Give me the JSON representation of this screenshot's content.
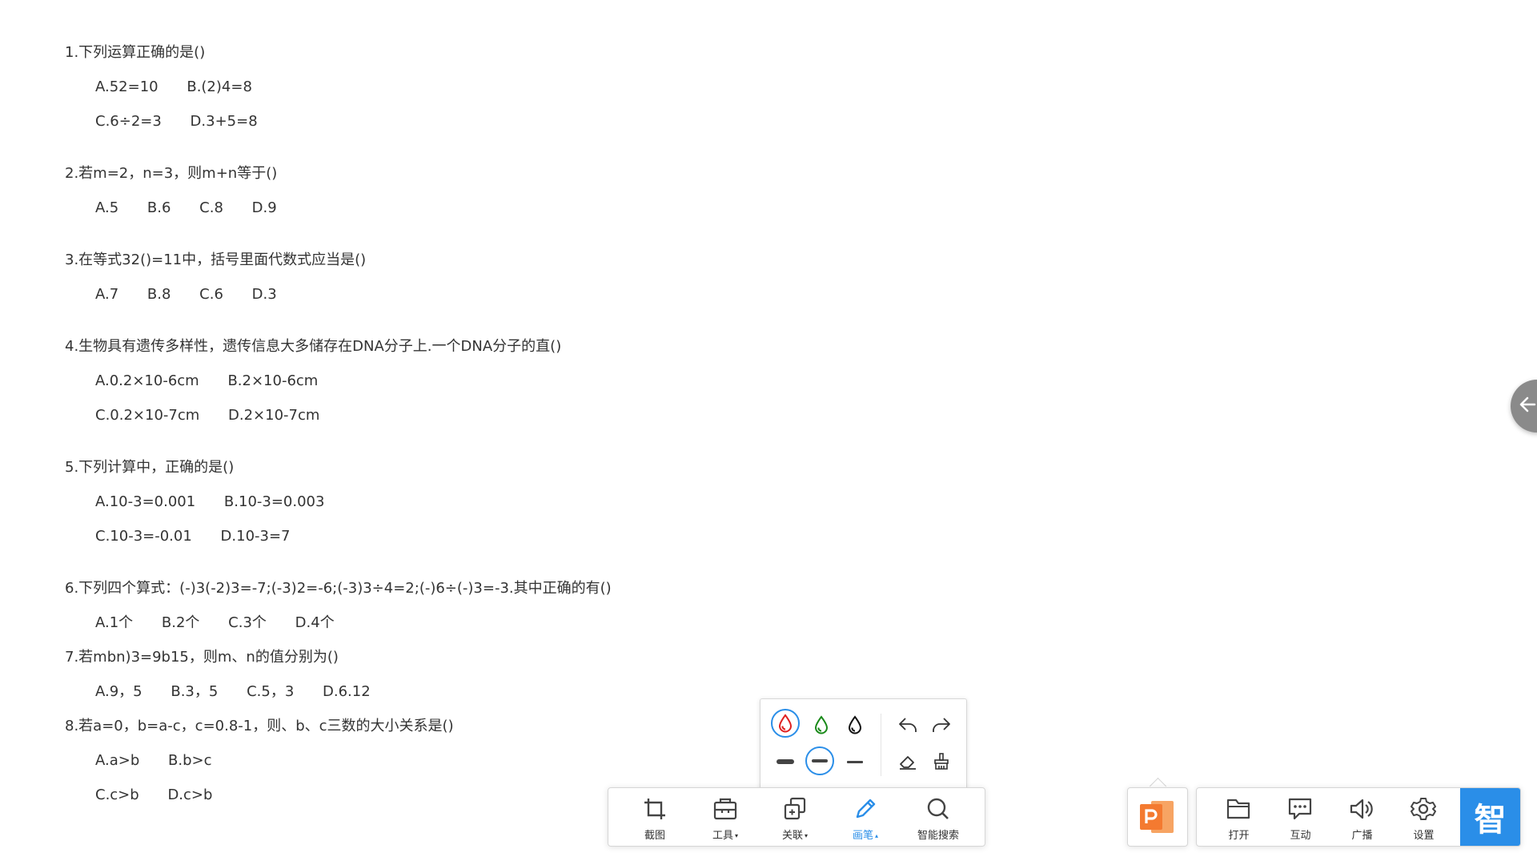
{
  "questions": [
    {
      "text": "1.下列运算正确的是()",
      "rows": [
        [
          "A.52=10",
          "B.(2)4=8"
        ],
        [
          "C.6÷2=3",
          "D.3+5=8"
        ]
      ]
    },
    {
      "text": "2.若m=2，n=3，则m+n等于()",
      "rows": [
        [
          "A.5",
          "B.6",
          "C.8",
          "D.9"
        ]
      ]
    },
    {
      "text": "3.在等式32()=11中，括号里面代数式应当是()",
      "rows": [
        [
          "A.7",
          "B.8",
          "C.6",
          "D.3"
        ]
      ]
    },
    {
      "text": "4.生物具有遗传多样性，遗传信息大多储存在DNA分子上.一个DNA分子的直()",
      "rows": [
        [
          "A.0.2×10-6cm",
          "B.2×10-6cm"
        ],
        [
          "C.0.2×10-7cm",
          "D.2×10-7cm"
        ]
      ]
    },
    {
      "text": "5.下列计算中，正确的是()",
      "rows": [
        [
          "A.10-3=0.001",
          "B.10-3=0.003"
        ],
        [
          "C.10-3=-0.01",
          "D.10-3=7"
        ]
      ]
    },
    {
      "text": "6.下列四个算式：(-)3(-2)3=-7;(-3)2=-6;(-3)3÷4=2;(-)6÷(-)3=-3.其中正确的有()",
      "rows": [
        [
          "A.1个",
          "B.2个",
          "C.3个",
          "D.4个"
        ]
      ]
    },
    {
      "text": "7.若mbn)3=9b15，则m、n的值分别为()",
      "rows": [
        [
          "A.9，5",
          "B.3，5",
          "C.5，3",
          "D.6.12"
        ]
      ]
    },
    {
      "text": "8.若a=0，b=a-c，c=0.8-1，则、b、c三数的大小关系是()",
      "rows": [
        [
          "A.a>b",
          "B.b>c"
        ],
        [
          "C.c>b",
          "D.c>b"
        ]
      ]
    }
  ],
  "pen_popup": {
    "colors": [
      {
        "name": "red",
        "hex": "#e02020",
        "selected": true
      },
      {
        "name": "green",
        "hex": "#1a8a1a",
        "selected": false
      },
      {
        "name": "black",
        "hex": "#111111",
        "selected": false
      }
    ],
    "widths": [
      {
        "name": "thick",
        "selected": false
      },
      {
        "name": "medium",
        "selected": true
      },
      {
        "name": "thin",
        "selected": false
      }
    ],
    "actions": [
      "undo-icon",
      "redo-icon",
      "eraser-icon",
      "clear-brush-icon"
    ]
  },
  "toolbar": {
    "items": [
      {
        "label": "截图",
        "icon": "crop-icon",
        "caret": ""
      },
      {
        "label": "工具",
        "icon": "toolbox-icon",
        "caret": "▾"
      },
      {
        "label": "关联",
        "icon": "link-pages-icon",
        "caret": "▾"
      },
      {
        "label": "画笔",
        "icon": "pen-icon",
        "caret": "▴",
        "active": true
      },
      {
        "label": "智能搜索",
        "icon": "search-icon",
        "caret": ""
      }
    ]
  },
  "ppt_tab": {
    "icon": "powerpoint-icon",
    "color": "#f47a30"
  },
  "right_bar": {
    "items": [
      {
        "label": "打开",
        "icon": "folder-icon"
      },
      {
        "label": "互动",
        "icon": "chat-icon"
      },
      {
        "label": "广播",
        "icon": "speaker-icon"
      },
      {
        "label": "设置",
        "icon": "gear-icon"
      }
    ],
    "zhi_label": "智",
    "accent": "#2a8ee8"
  }
}
